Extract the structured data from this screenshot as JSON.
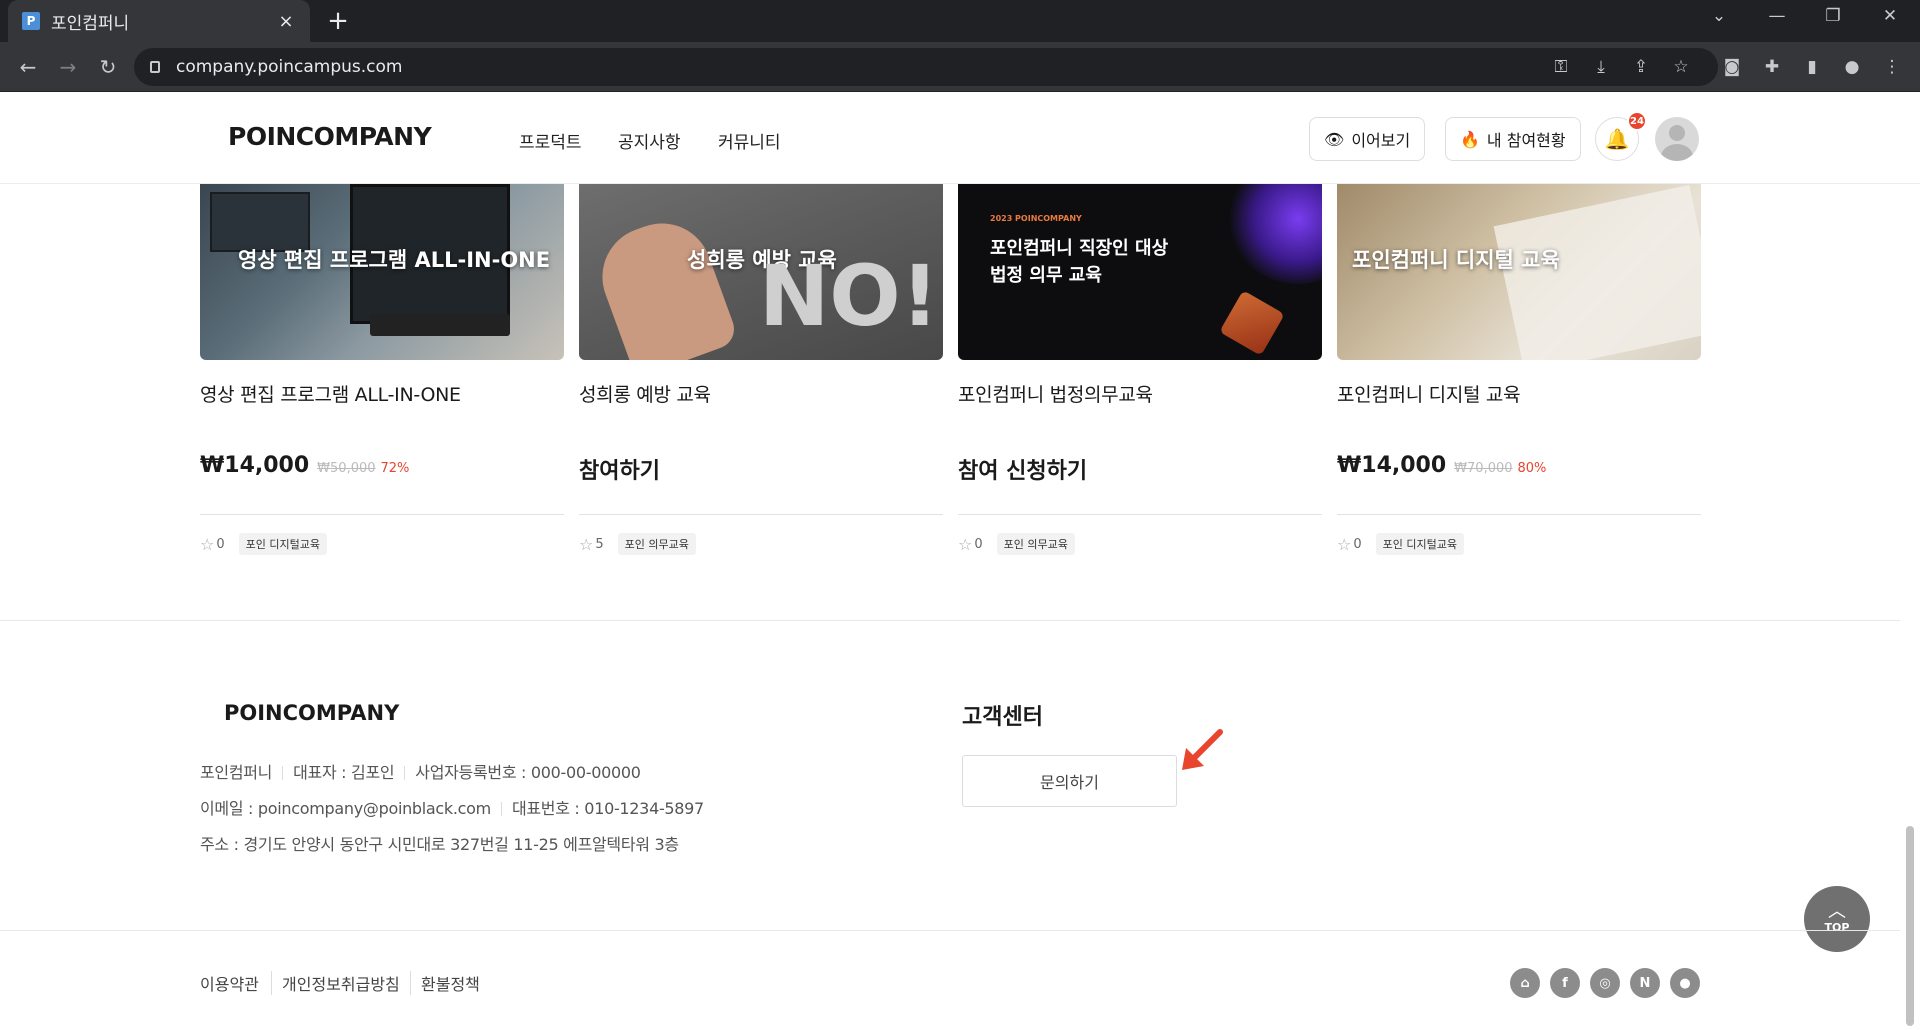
{
  "browser": {
    "tab_title": "포인컴퍼니",
    "tab_favicon": "P",
    "close_tab": "×",
    "new_tab": "+",
    "url": "company.poincampus.com"
  },
  "header": {
    "logo": "POINCOMPANY",
    "nav": [
      "프로덕트",
      "공지사항",
      "커뮤니티"
    ],
    "continue_label": "이어보기",
    "participation_label": "내 참여현황",
    "notification_count": "24"
  },
  "products": [
    {
      "thumb_text": "영상 편집 프로그램 ALL-IN-ONE",
      "title": "영상 편집 프로그램 ALL-IN-ONE",
      "price": "₩14,000",
      "original_price": "₩50,000",
      "discount": "72%",
      "rating": "0",
      "tag": "포인 디지털교육"
    },
    {
      "thumb_text": "성희롱 예방 교육",
      "thumb_big": "NO!",
      "title": "성희롱 예방 교육",
      "cta": "참여하기",
      "rating": "5",
      "tag": "포인 의무교육"
    },
    {
      "thumb_small": "2023 POINCOMPANY",
      "thumb_line1": "포인컴퍼니 직장인 대상",
      "thumb_line2": "법정 의무 교육",
      "title": "포인컴퍼니 법정의무교육",
      "cta": "참여 신청하기",
      "rating": "0",
      "tag": "포인 의무교육"
    },
    {
      "thumb_text": "포인컴퍼니 디지털 교육",
      "title": "포인컴퍼니 디지털 교육",
      "price": "₩14,000",
      "original_price": "₩70,000",
      "discount": "80%",
      "rating": "0",
      "tag": "포인 디지털교육"
    }
  ],
  "footer": {
    "logo": "POINCOMPANY",
    "company": "포인컴퍼니",
    "ceo": "대표자 : 김포인",
    "biz_no": "사업자등록번호 : 000-00-00000",
    "email": "이메일 : poincompany@poinblack.com",
    "phone": "대표번호 : 010-1234-5897",
    "address": "주소 : 경기도 안양시 동안구 시민대로 327번길 11-25 에프알텍타워 3층",
    "cs_title": "고객센터",
    "cs_button": "문의하기",
    "links": [
      "이용약관",
      "개인정보취급방침",
      "환불정책"
    ],
    "social_icons": [
      "home-icon",
      "facebook-icon",
      "instagram-icon",
      "naver-icon",
      "chat-icon"
    ]
  },
  "top_button": "TOP",
  "colors": {
    "accent": "#e8442e",
    "text": "#1a1a1a"
  }
}
